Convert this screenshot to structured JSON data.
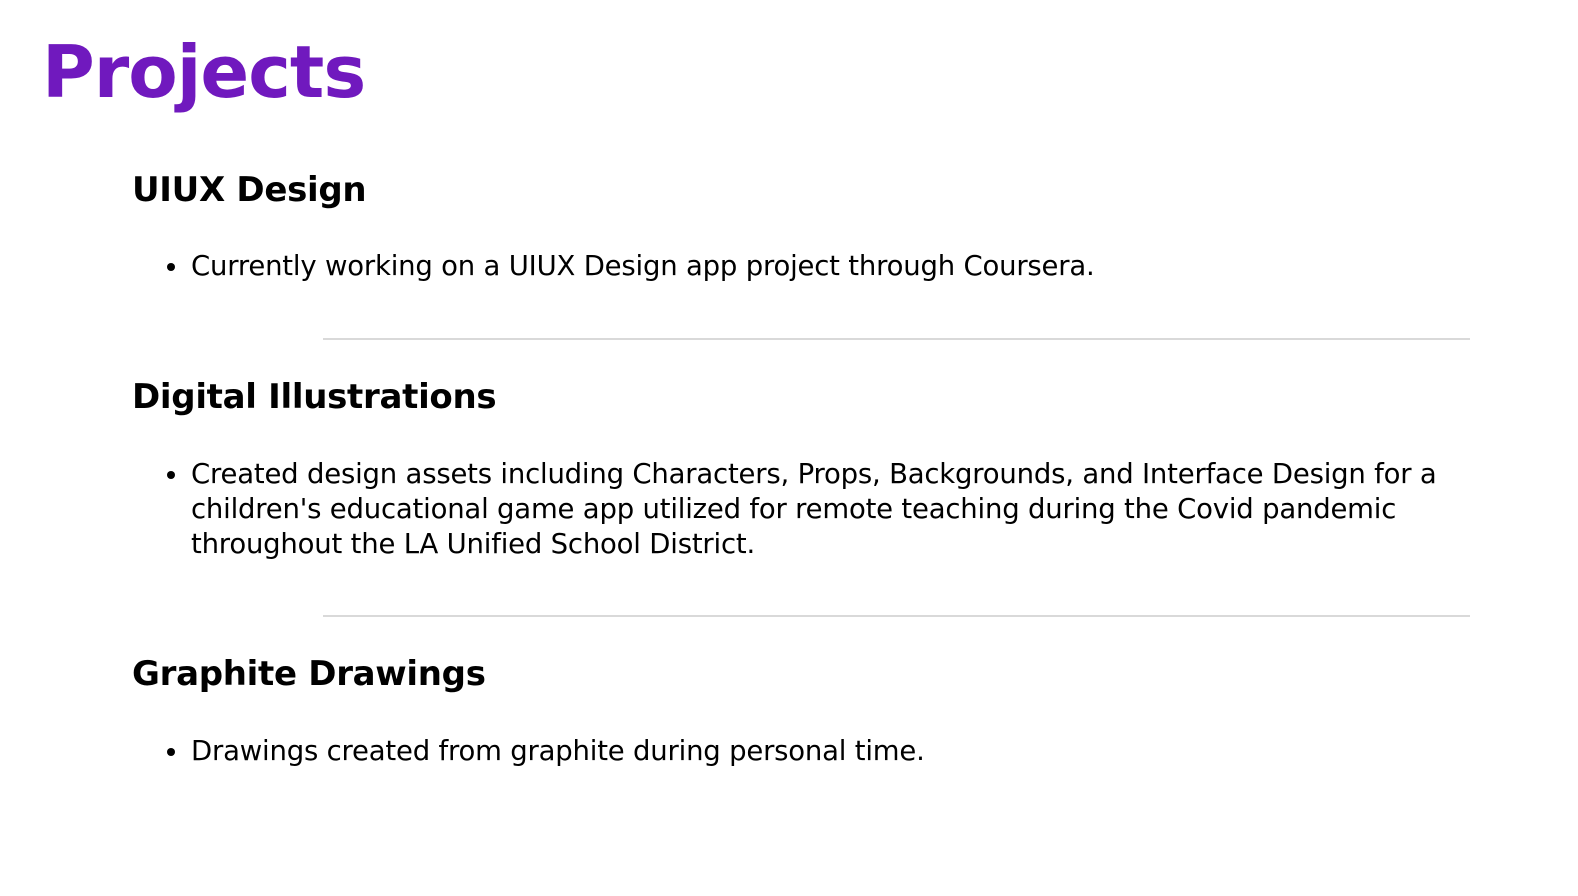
{
  "page": {
    "title": "Projects",
    "title_color": "#7019be",
    "divider_color": "#d9d9d9"
  },
  "sections": [
    {
      "heading": "UIUX Design",
      "items": [
        "Currently working on a UIUX Design app project through Coursera."
      ]
    },
    {
      "heading": "Digital Illustrations",
      "items": [
        "Created design assets including Characters, Props, Backgrounds, and Interface Design for a children's educational game app utilized for remote teaching during the Covid pandemic throughout the LA Unified School District."
      ]
    },
    {
      "heading": "Graphite Drawings",
      "items": [
        "Drawings created from graphite during personal time."
      ]
    }
  ]
}
